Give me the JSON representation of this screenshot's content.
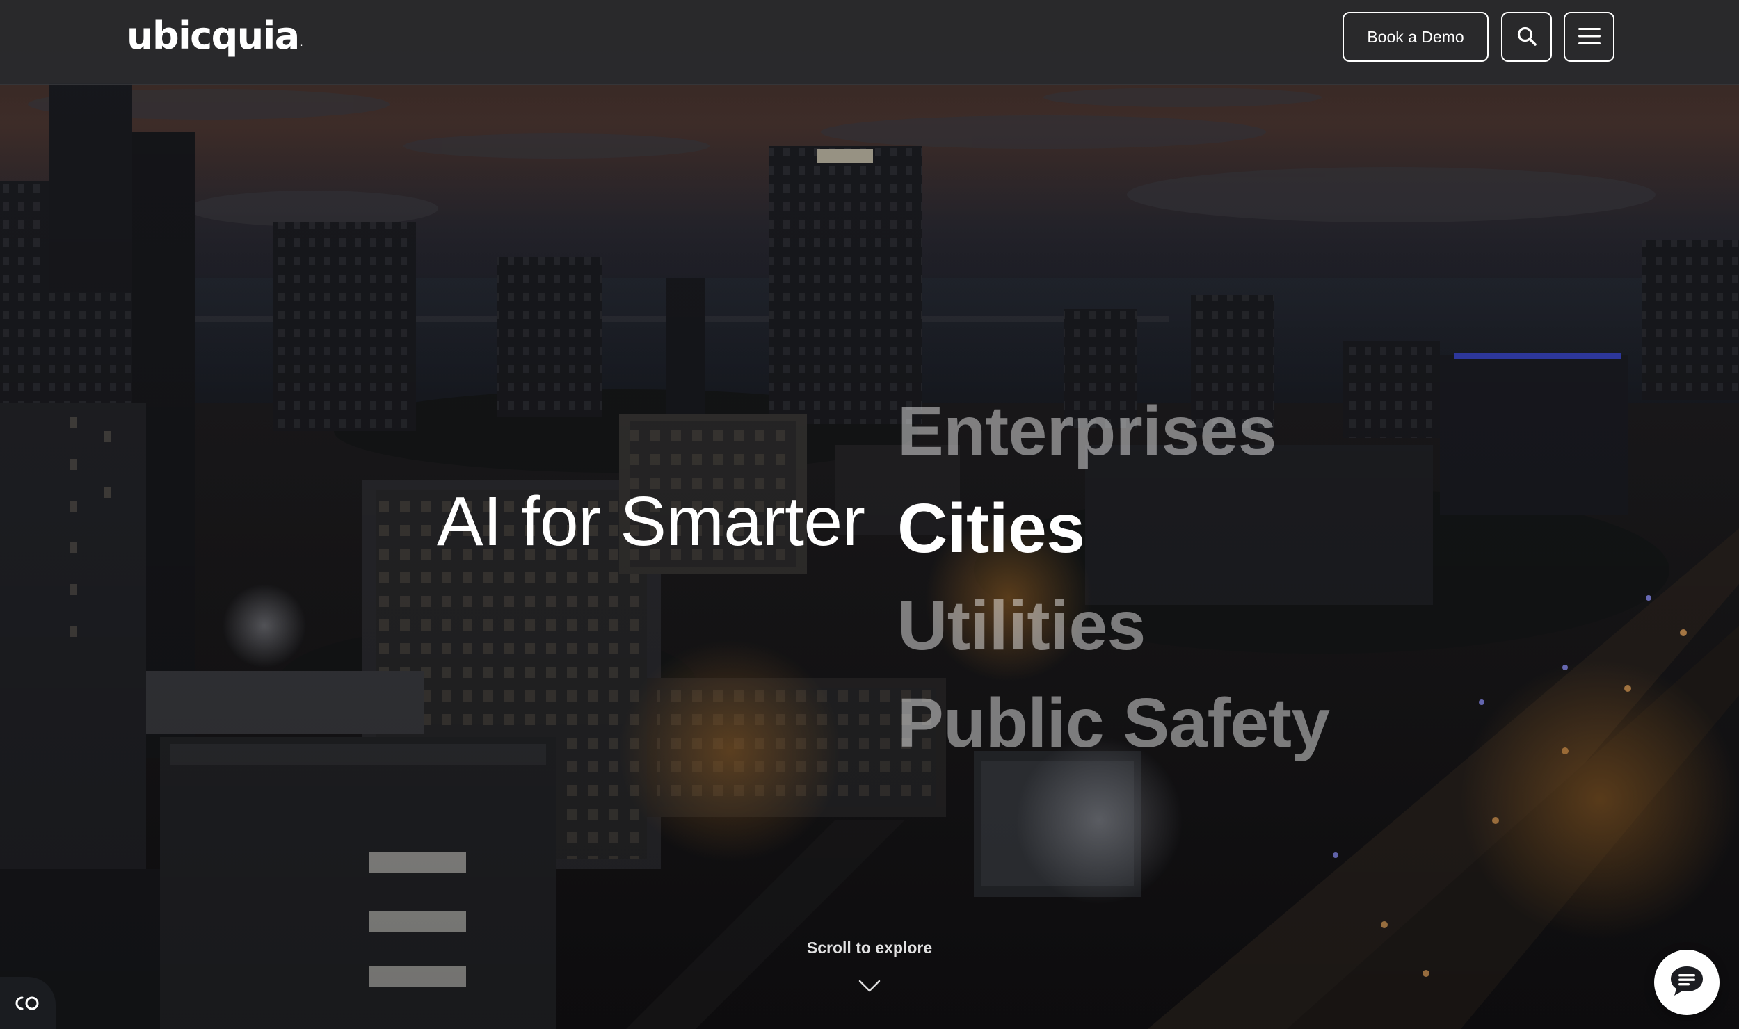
{
  "header": {
    "logo_text": "ubicquia",
    "logo_mark": ".",
    "book_demo_label": "Book a Demo"
  },
  "hero": {
    "headline_static": "AI for Smarter",
    "rotating_words": [
      {
        "label": "Enterprises",
        "active": false
      },
      {
        "label": "Cities",
        "active": true
      },
      {
        "label": "Utilities",
        "active": false
      },
      {
        "label": "Public Safety",
        "active": false
      }
    ],
    "scroll_label": "Scroll to explore"
  },
  "icons": {
    "search": "search-icon",
    "menu": "hamburger-menu-icon",
    "chevron": "chevron-down-icon",
    "accessibility": "accessibility-toggle-icon",
    "chat": "chat-bubble-icon"
  },
  "colors": {
    "header_bg": "#28292c",
    "text_primary": "#ffffff",
    "text_inactive": "rgba(255,255,255,0.45)"
  }
}
